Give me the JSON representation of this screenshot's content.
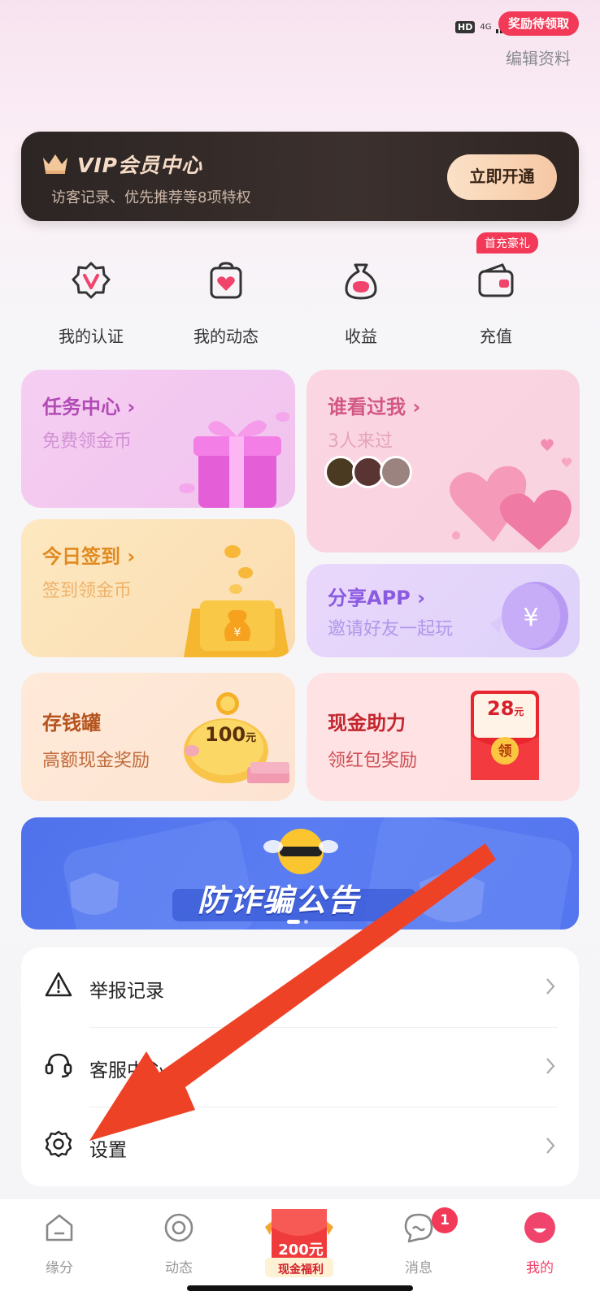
{
  "status_bar": {
    "hd": "HD",
    "network": "4G",
    "reward_pill": "奖励待领取"
  },
  "header": {
    "edit_profile": "编辑资料"
  },
  "vip": {
    "title": "VIP会员中心",
    "subtitle": "访客记录、优先推荐等8项特权",
    "button": "立即开通"
  },
  "quick": [
    {
      "label": "我的认证",
      "icon": "verified-badge-icon"
    },
    {
      "label": "我的动态",
      "icon": "heart-bag-icon"
    },
    {
      "label": "收益",
      "icon": "money-bag-icon"
    },
    {
      "label": "充值",
      "icon": "wallet-icon",
      "badge": "首充豪礼"
    }
  ],
  "cards": {
    "task": {
      "title": "任务中心",
      "subtitle": "免费领金币"
    },
    "visitors": {
      "title": "谁看过我",
      "subtitle": "3人来过"
    },
    "signin": {
      "title": "今日签到",
      "subtitle": "签到领金币"
    },
    "share": {
      "title": "分享APP",
      "subtitle": "邀请好友一起玩"
    },
    "jar": {
      "title": "存钱罐",
      "subtitle": "高额现金奖励",
      "amount": "100",
      "unit": "元"
    },
    "cash": {
      "title": "现金助力",
      "subtitle": "领红包奖励",
      "amount": "28",
      "unit": "元",
      "claim": "领"
    }
  },
  "banner": {
    "text": "防诈骗公告"
  },
  "menu": [
    {
      "label": "举报记录",
      "icon": "warning-icon"
    },
    {
      "label": "客服中心",
      "icon": "headset-icon"
    },
    {
      "label": "设置",
      "icon": "gear-icon"
    }
  ],
  "tabbar": {
    "tabs": [
      {
        "label": "缘分",
        "icon": "home-icon"
      },
      {
        "label": "动态",
        "icon": "circle-icon"
      },
      {
        "label": "消息",
        "icon": "chat-icon",
        "badge": "1"
      },
      {
        "label": "我的",
        "icon": "profile-icon"
      }
    ],
    "cash": {
      "amount": "200元",
      "label": "现金福利"
    }
  },
  "colors": {
    "accent": "#f23a58",
    "vip_gold": "#f6dcc6",
    "banner_blue": "#5577ef"
  }
}
